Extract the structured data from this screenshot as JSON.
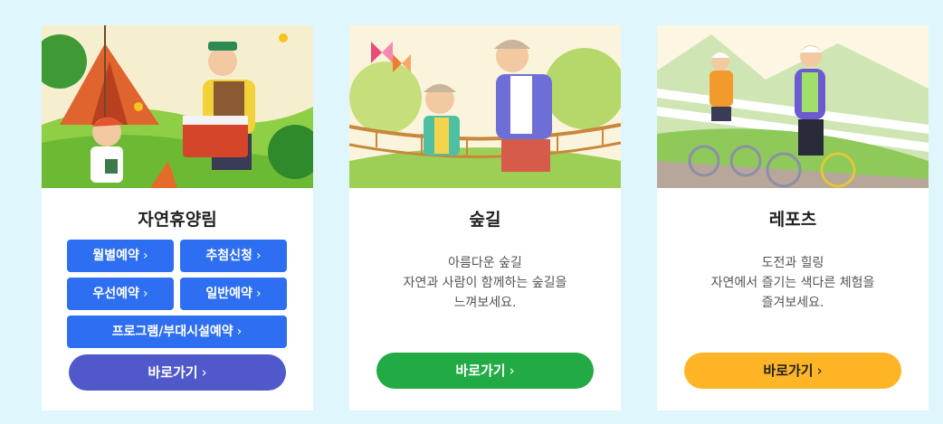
{
  "cards": [
    {
      "title": "자연휴양림",
      "buttons": [
        {
          "label": "월별예약",
          "chevron": "›"
        },
        {
          "label": "추첨신청",
          "chevron": "›"
        },
        {
          "label": "우선예약",
          "chevron": "›"
        },
        {
          "label": "일반예약",
          "chevron": "›"
        },
        {
          "label": "프로그램/부대시설예약",
          "chevron": "›"
        }
      ],
      "go": {
        "label": "바로가기",
        "chevron": "›",
        "color": "#5059c9"
      },
      "illustration": "camping-family-illustration"
    },
    {
      "title": "숲길",
      "description": [
        "아름다운 숲길",
        "자연과 사람이 함께하는 숲길을",
        "느껴보세요."
      ],
      "go": {
        "label": "바로가기",
        "chevron": "›",
        "color": "#22aa45"
      },
      "illustration": "forest-bridge-illustration"
    },
    {
      "title": "레포츠",
      "description": [
        "도전과 힐링",
        "자연에서 즐기는 색다른 체험을",
        "즐겨보세요."
      ],
      "go": {
        "label": "바로가기",
        "chevron": "›",
        "color": "#ffb526"
      },
      "illustration": "cycling-illustration"
    }
  ],
  "colors": {
    "page_background": "#dff6fd",
    "reservation_button": "#2e6ff2"
  }
}
